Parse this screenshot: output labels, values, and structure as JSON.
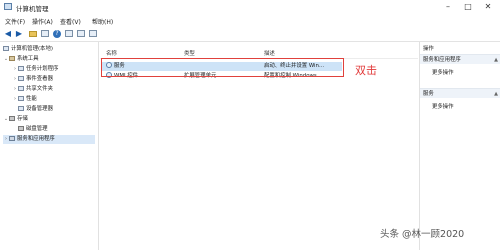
{
  "window": {
    "title": "计算机管理"
  },
  "window_controls": {
    "minimize": "–",
    "maximize": "□",
    "close": "✕"
  },
  "menu": [
    "文件(F)",
    "操作(A)",
    "查看(V)",
    "帮助(H)"
  ],
  "toolbar": {
    "icons": [
      "back-icon",
      "forward-icon",
      "folder-icon",
      "console-icon",
      "help-icon",
      "properties-icon",
      "console-tree-icon",
      "export-list-icon"
    ]
  },
  "tree": {
    "root": "计算机管理(本地)",
    "system_tools": "系统工具",
    "task_scheduler": "任务计划程序",
    "event_viewer": "事件查看器",
    "shared_folders": "共享文件夹",
    "performance": "性能",
    "device_manager": "设备管理器",
    "storage": "存储",
    "disk_management": "磁盘管理",
    "services_apps": "服务和应用程序"
  },
  "list": {
    "columns": [
      "名称",
      "类型",
      "描述"
    ],
    "rows": [
      {
        "name": "服务",
        "type": "",
        "desc": "启动、终止并设置 Win..."
      },
      {
        "name": "WMI 控件",
        "type": "扩展管理单元",
        "desc": "配置和控制 Windows ..."
      }
    ]
  },
  "annotation": "双击",
  "actions": {
    "header": "操作",
    "sections": [
      {
        "title": "服务和应用程序",
        "item": "更多操作"
      },
      {
        "title": "服务",
        "item": "更多操作"
      }
    ]
  },
  "watermark": "头条 @林一顾2020",
  "colors": {
    "highlight_box": "#e0413c",
    "annotation_text": "#e23b3b",
    "selection": "#cde3f7"
  }
}
